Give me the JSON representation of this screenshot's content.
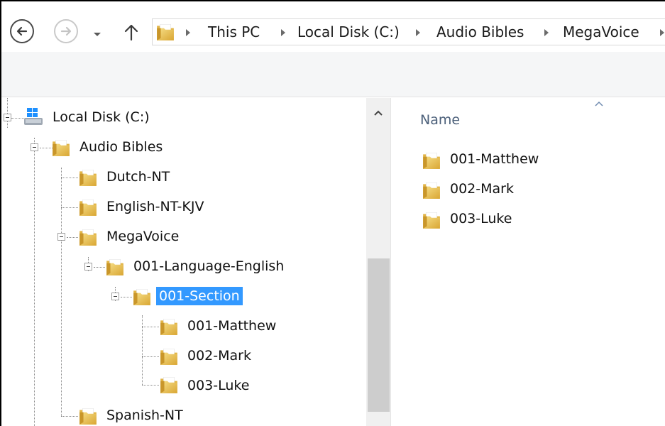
{
  "breadcrumb": [
    "This PC",
    "Local Disk (C:)",
    "Audio Bibles",
    "MegaVoice"
  ],
  "tree": {
    "root": "Local Disk (C:)",
    "items": [
      {
        "label": "Audio Bibles"
      },
      {
        "label": "Dutch-NT"
      },
      {
        "label": "English-NT-KJV"
      },
      {
        "label": "MegaVoice"
      },
      {
        "label": "001-Language-English"
      },
      {
        "label": "001-Section",
        "selected": true
      },
      {
        "label": "001-Matthew"
      },
      {
        "label": "002-Mark"
      },
      {
        "label": "003-Luke"
      },
      {
        "label": "Spanish-NT"
      }
    ]
  },
  "content": {
    "column_header": "Name",
    "files": [
      "001-Matthew",
      "002-Mark",
      "003-Luke"
    ]
  },
  "colors": {
    "selection": "#3399ff",
    "folder": "#e8bc4c",
    "header_text": "#4c607a"
  },
  "icons": [
    "back-arrow-icon",
    "forward-arrow-icon",
    "recent-locations-chevron-icon",
    "up-arrow-icon",
    "folder-icon",
    "drive-icon",
    "collapse-icon",
    "sort-ascending-icon",
    "breadcrumb-separator-icon"
  ]
}
